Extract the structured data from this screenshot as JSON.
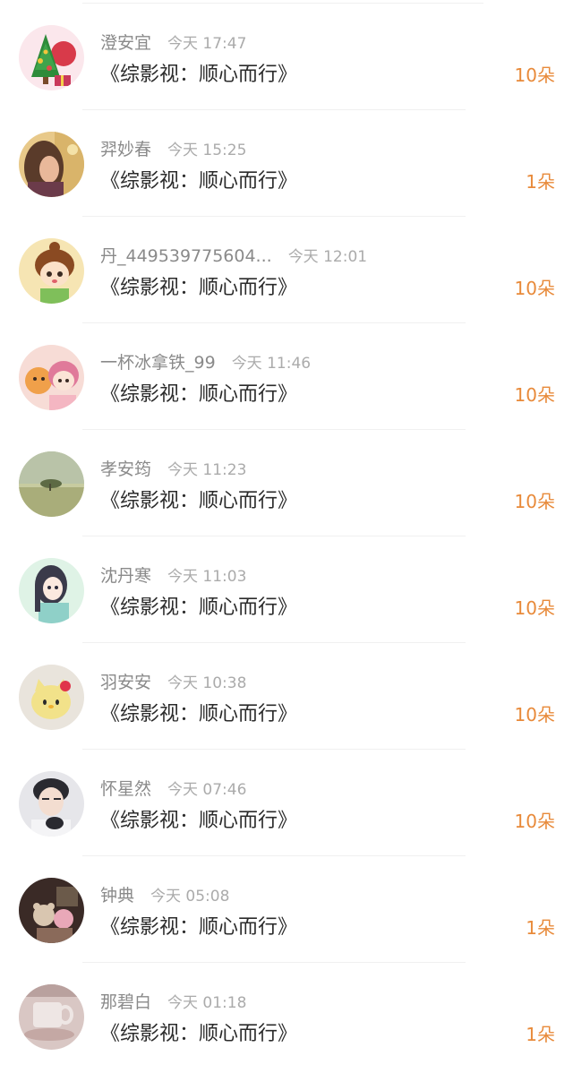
{
  "gift_list": [
    {
      "name": "澄安宜",
      "time": "今天 17:47",
      "title": "《综影视：顺心而行》",
      "count": "10朵",
      "avatar": "christmas-tree-avatar"
    },
    {
      "name": "羿妙春",
      "time": "今天 15:25",
      "title": "《综影视：顺心而行》",
      "count": "1朵",
      "avatar": "girl-photo-avatar"
    },
    {
      "name": "丹_449539775604...",
      "time": "今天 12:01",
      "title": "《综影视：顺心而行》",
      "count": "10朵",
      "avatar": "cartoon-girl-avatar"
    },
    {
      "name": "一杯冰拿铁_99",
      "time": "今天 11:46",
      "title": "《综影视：顺心而行》",
      "count": "10朵",
      "avatar": "cartoon-duo-avatar"
    },
    {
      "name": "孝安筠",
      "time": "今天 11:23",
      "title": "《综影视：顺心而行》",
      "count": "10朵",
      "avatar": "landscape-tree-avatar"
    },
    {
      "name": "沈丹寒",
      "time": "今天 11:03",
      "title": "《综影视：顺心而行》",
      "count": "10朵",
      "avatar": "anime-girl-avatar"
    },
    {
      "name": "羽安安",
      "time": "今天 10:38",
      "title": "《综影视：顺心而行》",
      "count": "10朵",
      "avatar": "hello-kitty-avatar"
    },
    {
      "name": "怀星然",
      "time": "今天 07:46",
      "title": "《综影视：顺心而行》",
      "count": "10朵",
      "avatar": "young-man-avatar"
    },
    {
      "name": "钟典",
      "time": "今天 05:08",
      "title": "《综影视：顺心而行》",
      "count": "1朵",
      "avatar": "plush-toys-avatar"
    },
    {
      "name": "那碧白",
      "time": "今天 01:18",
      "title": "《综影视：顺心而行》",
      "count": "1朵",
      "avatar": "teacup-avatar"
    }
  ],
  "colors": {
    "accent": "#e88a3a",
    "name_text": "#8a8a8a",
    "time_text": "#ababab",
    "title_text": "#2b2b2b",
    "divider": "#f0f0f0"
  }
}
